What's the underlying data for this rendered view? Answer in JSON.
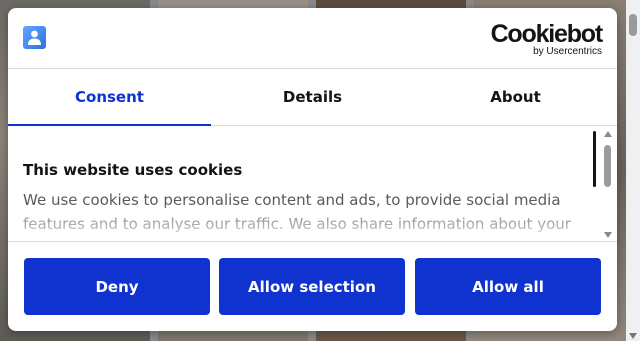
{
  "brand": {
    "name": "Cookiebot",
    "byline": "by Usercentrics"
  },
  "tabs": [
    {
      "label": "Consent",
      "active": true
    },
    {
      "label": "Details",
      "active": false
    },
    {
      "label": "About",
      "active": false
    }
  ],
  "consent": {
    "heading": "This website uses cookies",
    "body": "We use cookies to personalise content and ads, to provide social media features and to analyse our traffic. We also share information about your"
  },
  "buttons": {
    "deny": "Deny",
    "allow_selection": "Allow selection",
    "allow_all": "Allow all"
  },
  "colors": {
    "accent": "#1032cf",
    "text": "#141414"
  },
  "icons": {
    "site_logo": "site-logo-icon"
  }
}
